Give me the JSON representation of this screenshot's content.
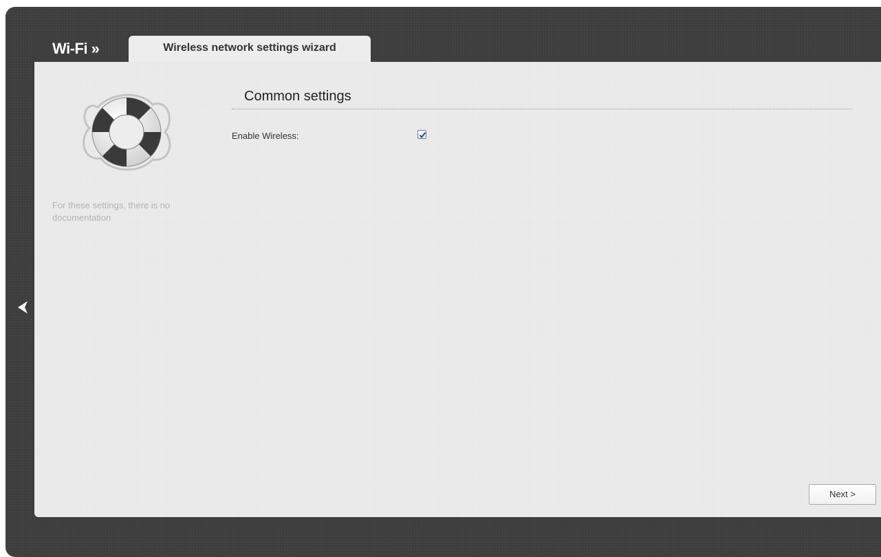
{
  "header": {
    "breadcrumb_root": "Wi-Fi »",
    "active_tab": "Wireless network settings wizard"
  },
  "sidebar": {
    "icon": "lifebuoy-icon",
    "note": "For these settings, there is no documentation"
  },
  "main": {
    "section_title": "Common settings",
    "fields": {
      "enable_wireless": {
        "label": "Enable Wireless:",
        "checked": true
      }
    }
  },
  "footer": {
    "next_label": "Next >"
  },
  "nav": {
    "back_icon": "chevron-left-icon"
  },
  "colors": {
    "frame": "#3d3d3d",
    "panel": "#ededed",
    "check_accent": "#2a4d9b"
  }
}
